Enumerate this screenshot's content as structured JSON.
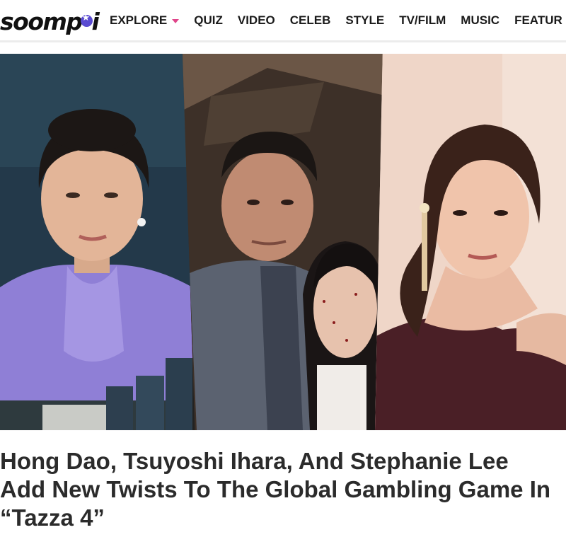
{
  "header": {
    "logo_text_left": "soom",
    "logo_text_right": "i",
    "logo_letter_p": "p",
    "nav": [
      {
        "label": "EXPLORE",
        "has_dropdown": true
      },
      {
        "label": "QUIZ"
      },
      {
        "label": "VIDEO"
      },
      {
        "label": "CELEB"
      },
      {
        "label": "STYLE"
      },
      {
        "label": "TV/FILM"
      },
      {
        "label": "MUSIC"
      },
      {
        "label": "FEATUR"
      }
    ],
    "accent_color": "#e0458a",
    "logo_star_color": "#5a4bd1"
  },
  "hero": {
    "icon": "photo-collage"
  },
  "article": {
    "headline": "Hong Dao, Tsuyoshi Ihara, And Stephanie Lee Add New Twists To The Global Gambling Game In “Tazza 4”"
  }
}
